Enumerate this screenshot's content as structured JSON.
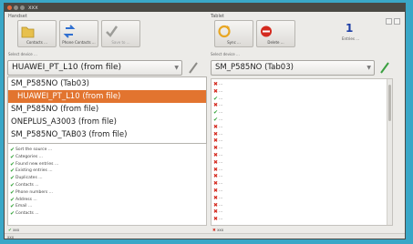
{
  "window": {
    "title": "xxx"
  },
  "left": {
    "group_label": "Handset",
    "buttons": {
      "b1": "Contacts ...",
      "b2": "Phone Contacts ...",
      "b3": "Save to ..."
    },
    "device_label": "Select device ...",
    "device_value": "HUAWEI_PT_L10 (from file)",
    "dropdown": [
      "SM_P585NO (Tab03)",
      "HUAWEI_PT_L10 (from file)",
      "SM_P585NO (from file)",
      "ONEPLUS_A3003 (from file)",
      "SM_P585NO_TAB03 (from file)"
    ],
    "rows": [
      "Sort the source ...",
      "Categories ...",
      "Found new entries ...",
      "Existing entries ...",
      "Duplicates ...",
      "Contacts ...",
      "Phone numbers ...",
      "Address ...",
      "Email ...",
      "Contacts ..."
    ],
    "status": "xxx"
  },
  "right": {
    "group_label": "Tablet",
    "buttons": {
      "b1": "Sync ...",
      "b2": "Delete ..."
    },
    "device_label": "Select device ...",
    "device_value": "SM_P585NO (Tab03)",
    "count": "1",
    "count_label": "Entries ...",
    "rows": [
      {
        "ok": false,
        "text": "..."
      },
      {
        "ok": false,
        "text": "..."
      },
      {
        "ok": true,
        "text": "..."
      },
      {
        "ok": false,
        "text": "..."
      },
      {
        "ok": true,
        "text": "..."
      },
      {
        "ok": true,
        "text": "..."
      },
      {
        "ok": false,
        "text": "..."
      },
      {
        "ok": false,
        "text": "..."
      },
      {
        "ok": false,
        "text": "..."
      },
      {
        "ok": false,
        "text": "..."
      },
      {
        "ok": false,
        "text": "..."
      },
      {
        "ok": false,
        "text": "..."
      },
      {
        "ok": false,
        "text": "..."
      },
      {
        "ok": false,
        "text": "..."
      },
      {
        "ok": false,
        "text": "..."
      },
      {
        "ok": false,
        "text": "..."
      },
      {
        "ok": false,
        "text": "..."
      },
      {
        "ok": false,
        "text": "..."
      },
      {
        "ok": false,
        "text": "..."
      },
      {
        "ok": false,
        "text": "..."
      }
    ],
    "status": "xxx"
  },
  "statusbar": "xxx",
  "colors": {
    "accent": "#e2742f",
    "ok": "#35a33a",
    "bad": "#d42a1f",
    "count": "#1e3fa6"
  }
}
